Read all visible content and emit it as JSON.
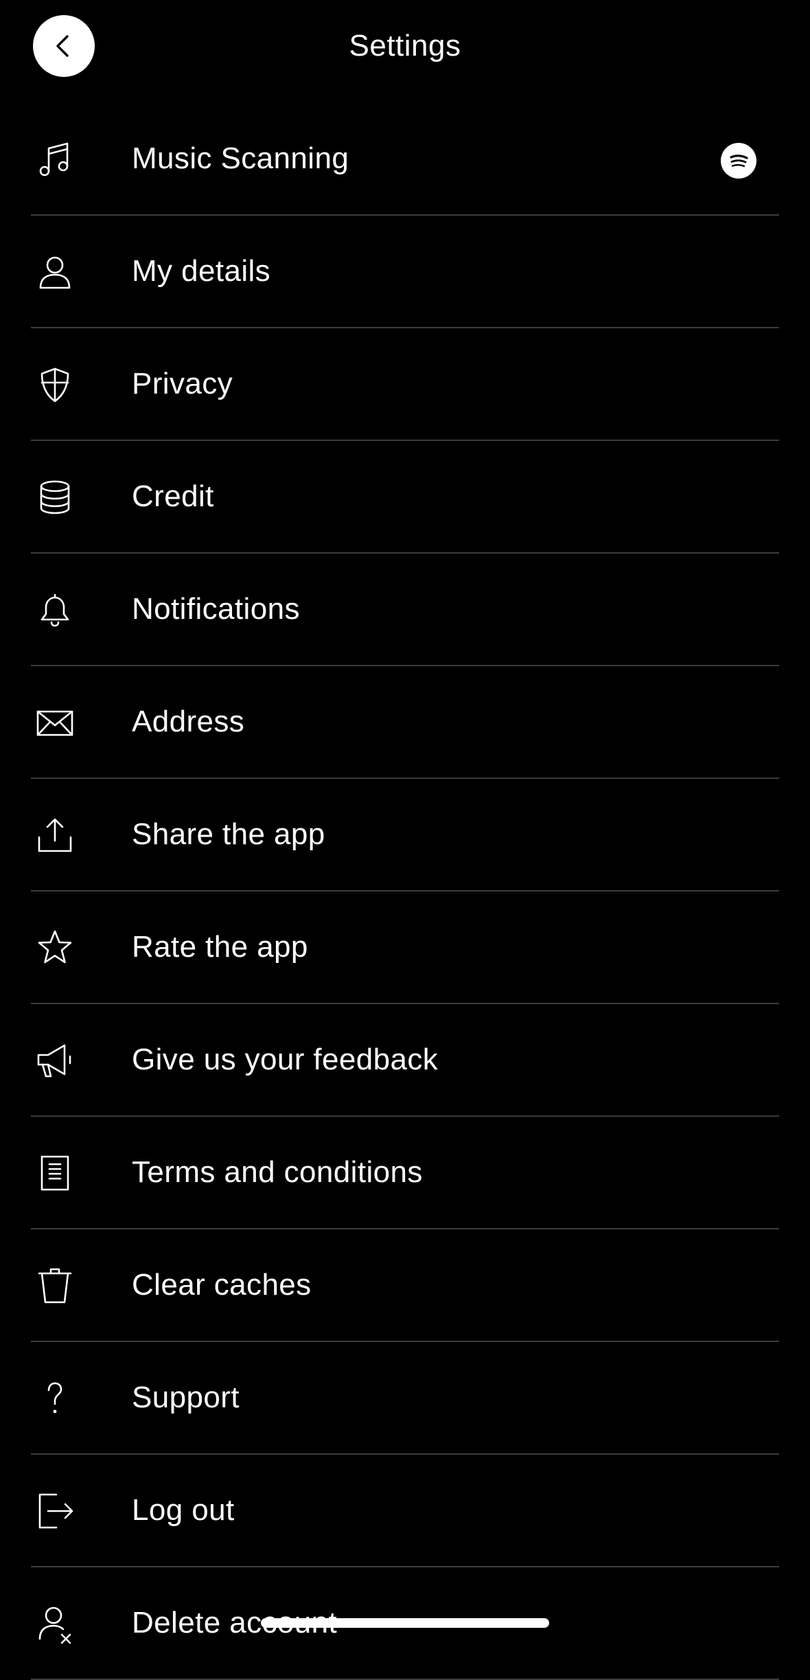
{
  "header": {
    "title": "Settings",
    "back_icon": "chevron-left-icon"
  },
  "menu": [
    {
      "label": "Music Scanning",
      "icon": "music-note-icon",
      "badge_icon": "spotify-icon"
    },
    {
      "label": "My details",
      "icon": "user-icon"
    },
    {
      "label": "Privacy",
      "icon": "shield-icon"
    },
    {
      "label": "Credit",
      "icon": "coins-stack-icon"
    },
    {
      "label": "Notifications",
      "icon": "bell-icon"
    },
    {
      "label": "Address",
      "icon": "envelope-icon"
    },
    {
      "label": "Share the app",
      "icon": "share-icon"
    },
    {
      "label": "Rate the app",
      "icon": "star-icon"
    },
    {
      "label": "Give us your feedback",
      "icon": "megaphone-icon"
    },
    {
      "label": "Terms and conditions",
      "icon": "document-icon"
    },
    {
      "label": "Clear caches",
      "icon": "trash-icon"
    },
    {
      "label": "Support",
      "icon": "question-icon"
    },
    {
      "label": "Log out",
      "icon": "logout-icon"
    },
    {
      "label": "Delete account",
      "icon": "user-remove-icon"
    }
  ],
  "colors": {
    "background": "#000000",
    "text": "#ffffff",
    "divider": "#3c3c3c"
  }
}
